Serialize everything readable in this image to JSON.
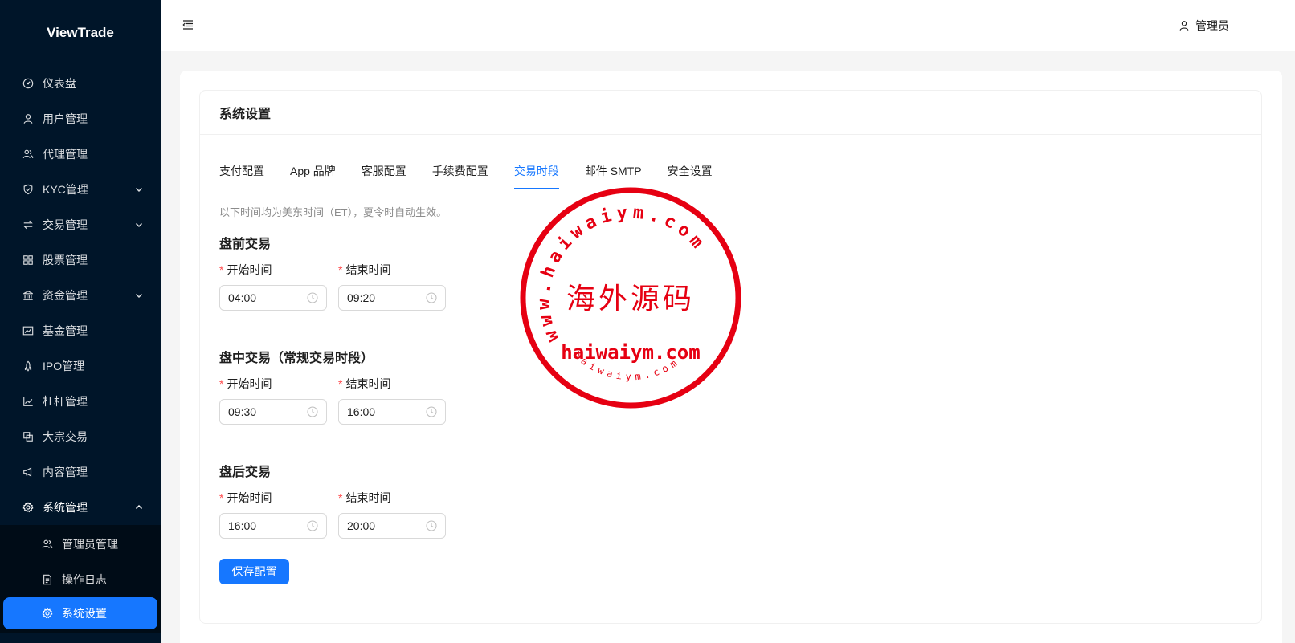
{
  "app": {
    "logo": "ViewTrade"
  },
  "sidebar": {
    "items": [
      {
        "label": "仪表盘",
        "icon": "dashboard-icon"
      },
      {
        "label": "用户管理",
        "icon": "user-icon"
      },
      {
        "label": "代理管理",
        "icon": "team-icon"
      },
      {
        "label": "KYC管理",
        "icon": "shield-check-icon"
      },
      {
        "label": "交易管理",
        "icon": "swap-icon"
      },
      {
        "label": "股票管理",
        "icon": "appstore-icon"
      },
      {
        "label": "资金管理",
        "icon": "bank-icon"
      },
      {
        "label": "基金管理",
        "icon": "fund-icon"
      },
      {
        "label": "IPO管理",
        "icon": "rocket-icon"
      },
      {
        "label": "杠杆管理",
        "icon": "line-chart-icon"
      },
      {
        "label": "大宗交易",
        "icon": "block-icon"
      },
      {
        "label": "内容管理",
        "icon": "notification-icon"
      },
      {
        "label": "系统管理",
        "icon": "setting-icon"
      }
    ],
    "sub_items": [
      {
        "label": "管理员管理",
        "icon": "team-icon"
      },
      {
        "label": "操作日志",
        "icon": "file-icon"
      },
      {
        "label": "系统设置",
        "icon": "setting-icon"
      }
    ]
  },
  "header": {
    "user_name": "管理员"
  },
  "page": {
    "title": "系统设置",
    "tabs": [
      "支付配置",
      "App 品牌",
      "客服配置",
      "手续费配置",
      "交易时段",
      "邮件 SMTP",
      "安全设置"
    ],
    "active_tab": "交易时段",
    "hint": "以下时间均为美东时间（ET），夏令时自动生效。",
    "sections": [
      {
        "title": "盘前交易",
        "start_label": "开始时间",
        "end_label": "结束时间",
        "start": "04:00",
        "end": "09:20"
      },
      {
        "title": "盘中交易（常规交易时段）",
        "start_label": "开始时间",
        "end_label": "结束时间",
        "start": "09:30",
        "end": "16:00"
      },
      {
        "title": "盘后交易",
        "start_label": "开始时间",
        "end_label": "结束时间",
        "start": "16:00",
        "end": "20:00"
      }
    ],
    "required_mark": "*",
    "save_label": "保存配置"
  },
  "watermark": {
    "ring_text": "www.haiwaiym.com",
    "center_text": "海外源码",
    "domain_text": "haiwaiym.com",
    "bottom_text": "haiwaiym.com",
    "color": "#e60012"
  },
  "colors": {
    "sidebar_bg": "#001529",
    "primary": "#1677ff",
    "required": "#ff4d4f"
  }
}
